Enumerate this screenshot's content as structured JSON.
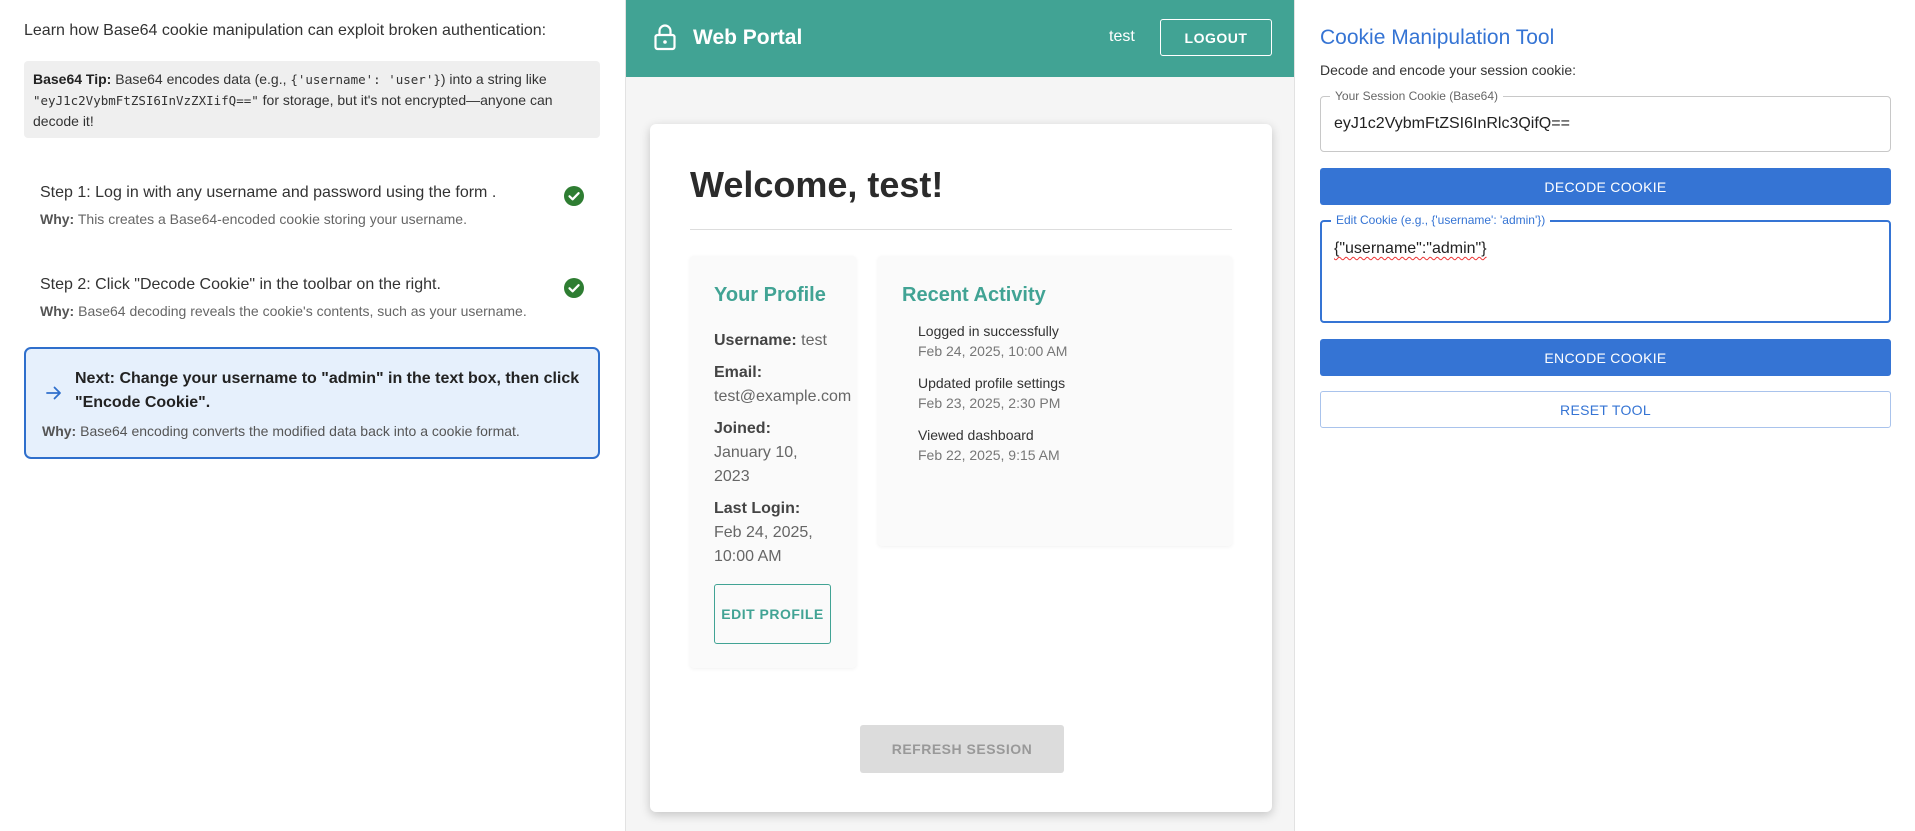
{
  "left": {
    "intro": "Learn how Base64 cookie manipulation can exploit broken authentication:",
    "tip": {
      "label": "Base64 Tip:",
      "text_1": " Base64 encodes data (e.g., ",
      "code_1": "{'username': 'user'}",
      "text_2": ") into a string like ",
      "code_2": "\"eyJ1c2VybmFtZSI6InVzZXIifQ==\"",
      "text_3": " for storage, but it's not encrypted—anyone can decode it!"
    },
    "steps": [
      {
        "title": "Step 1: Log in with any username and password using the form .",
        "why_label": "Why:",
        "why": " This creates a Base64-encoded cookie storing your username.",
        "status": "complete",
        "icon": "check-circle-icon"
      },
      {
        "title": "Step 2: Click \"Decode Cookie\" in the toolbar on the right.",
        "why_label": "Why:",
        "why": " Base64 decoding reveals the cookie's contents, such as your username.",
        "status": "complete",
        "icon": "check-circle-icon"
      }
    ],
    "next": {
      "title": "Next: Change your username to \"admin\" in the text box, then click \"Encode Cookie\".",
      "why_label": "Why:",
      "why": " Base64 encoding converts the modified data back into a cookie format.",
      "icon": "arrow-right-icon"
    }
  },
  "portal": {
    "brand": "Web Portal",
    "user": "test",
    "logout": "LOGOUT",
    "welcome": "Welcome, test!",
    "profile": {
      "title": "Your Profile",
      "username_label": "Username:",
      "username": "test",
      "email_label": "Email:",
      "email": "test@example.com",
      "joined_label": "Joined:",
      "joined": "January 10, 2023",
      "last_login_label": "Last Login:",
      "last_login": "Feb 24, 2025, 10:00 AM",
      "edit_button": "EDIT PROFILE"
    },
    "activity": {
      "title": "Recent Activity",
      "items": [
        {
          "action": "Logged in successfully",
          "date": "Feb 24, 2025, 10:00 AM"
        },
        {
          "action": "Updated profile settings",
          "date": "Feb 23, 2025, 2:30 PM"
        },
        {
          "action": "Viewed dashboard",
          "date": "Feb 22, 2025, 9:15 AM"
        }
      ]
    },
    "refresh": "REFRESH SESSION"
  },
  "tool": {
    "title": "Cookie Manipulation Tool",
    "subtitle": "Decode and encode your session cookie:",
    "cookie_legend": "Your Session Cookie (Base64)",
    "cookie_value": "eyJ1c2VybmFtZSI6InRlc3QifQ==",
    "decode": "DECODE COOKIE",
    "edit_legend": "Edit Cookie (e.g., {'username': 'admin'})",
    "edit_value": "{\"username\":\"admin\"}",
    "encode": "ENCODE COOKIE",
    "reset": "RESET TOOL"
  },
  "colors": {
    "teal": "#41a394",
    "blue": "#3574d4",
    "check_green": "#2e7d32"
  }
}
